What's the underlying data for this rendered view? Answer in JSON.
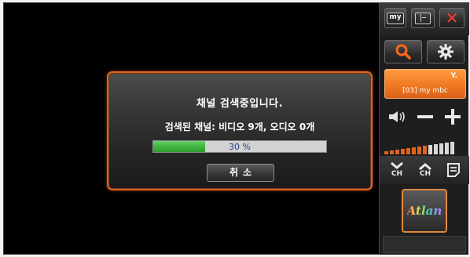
{
  "dialog": {
    "title": "채널 검색중입니다.",
    "status": "검색된 채널: 비디오 9개, 오디오 0개",
    "progress_percent": 30,
    "progress_label": "30 %",
    "cancel_label": "취소"
  },
  "panel": {
    "my_button": "my",
    "channel_label": "[03] my mbc",
    "ch_label": "CH",
    "logo_text": "Atlan"
  },
  "colors": {
    "accent": "#f07a22",
    "progress_fill": "#3fb43f",
    "close": "#ff3b2f"
  },
  "icons": [
    "my-icon",
    "minimize-window-icon",
    "close-icon",
    "search-icon",
    "gear-icon",
    "signal-antenna-icon",
    "speaker-icon",
    "volume-minus-icon",
    "volume-plus-icon",
    "channel-down-icon",
    "channel-up-icon",
    "list-icon"
  ]
}
